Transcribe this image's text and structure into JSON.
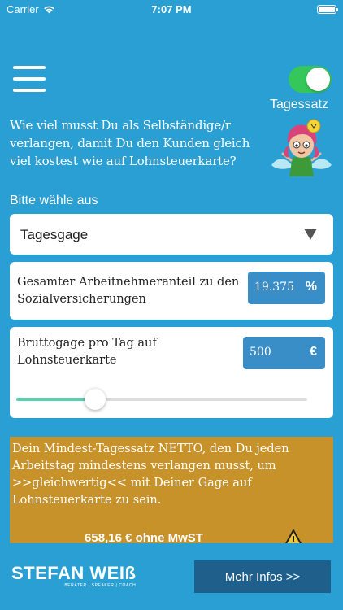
{
  "status_bar": {
    "carrier": "Carrier",
    "time": "7:07 PM"
  },
  "header": {
    "toggle_label": "Tagessatz",
    "toggle_on": true,
    "toggle_color": "#35c759"
  },
  "question": "Wie viel musst Du als Selbständige/r verlangen, damit Du den Kunden gleich viel kostest wie auf Lohnsteuerkarte?",
  "prompt": "Bitte wähle aus",
  "dropdown": {
    "selected": "Tagesgage"
  },
  "contribution": {
    "label": "Gesamter Arbeitnehmeranteil zu den Sozialversicherungen",
    "value": "19.375",
    "unit": "%"
  },
  "gross": {
    "label": "Bruttogage pro Tag auf Lohnsteuerkarte",
    "value": "500",
    "unit": "€",
    "slider_fraction": 0.27
  },
  "result": {
    "text": "Dein Mindest-Tagessatz NETTO, den Du jeden Arbeitstag mindestens verlangen musst, um >>gleichwertig<< mit Deiner Gage auf Lohnsteuerkarte zu sein.",
    "amount": "658,16 € ohne MwST",
    "color": "#c8922a"
  },
  "footer": {
    "brand": "STEFAN WEIß",
    "tagline": "BERATER | SPEAKER | COACH",
    "info_button": "Mehr Infos >>"
  },
  "colors": {
    "background": "#2a9fd4",
    "input_bg": "#3a8ec8",
    "button_bg": "#1e5f8c",
    "slider_fill": "#5ccfb0"
  }
}
